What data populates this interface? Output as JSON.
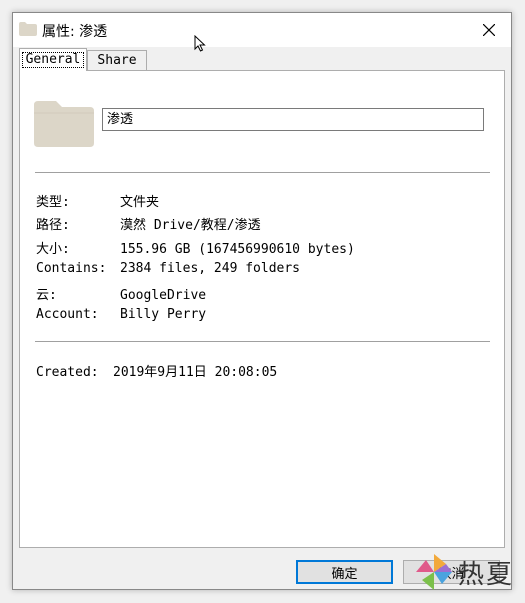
{
  "window": {
    "title": "属性: 渗透"
  },
  "tabs": [
    {
      "label": "General",
      "active": true
    },
    {
      "label": "Share",
      "active": false
    }
  ],
  "general": {
    "folder_name": "渗透",
    "type_label": "类型:",
    "type_value": "文件夹",
    "path_label": "路径:",
    "path_value": "漠然 Drive/教程/渗透",
    "size_label": "大小:",
    "size_value": "155.96 GB (167456990610 bytes)",
    "contains_label": "Contains:",
    "contains_value": "2384 files, 249 folders",
    "cloud_label": "云:",
    "cloud_value": "GoogleDrive",
    "account_label": "Account:",
    "account_value": "Billy Perry",
    "created_label": "Created:",
    "created_value": "2019年9月11日 20:08:05"
  },
  "buttons": {
    "ok": "确定",
    "cancel": "取消"
  },
  "watermark": {
    "text": "热夏"
  },
  "icons": {
    "title_folder": "folder-icon",
    "big_folder": "folder-icon",
    "close": "close-icon",
    "cursor": "mouse-cursor-icon"
  },
  "colors": {
    "folder": "#dcd6c8",
    "focus_border": "#0078d7",
    "panel_bg": "#ffffff",
    "window_bg": "#f0f0f0"
  }
}
